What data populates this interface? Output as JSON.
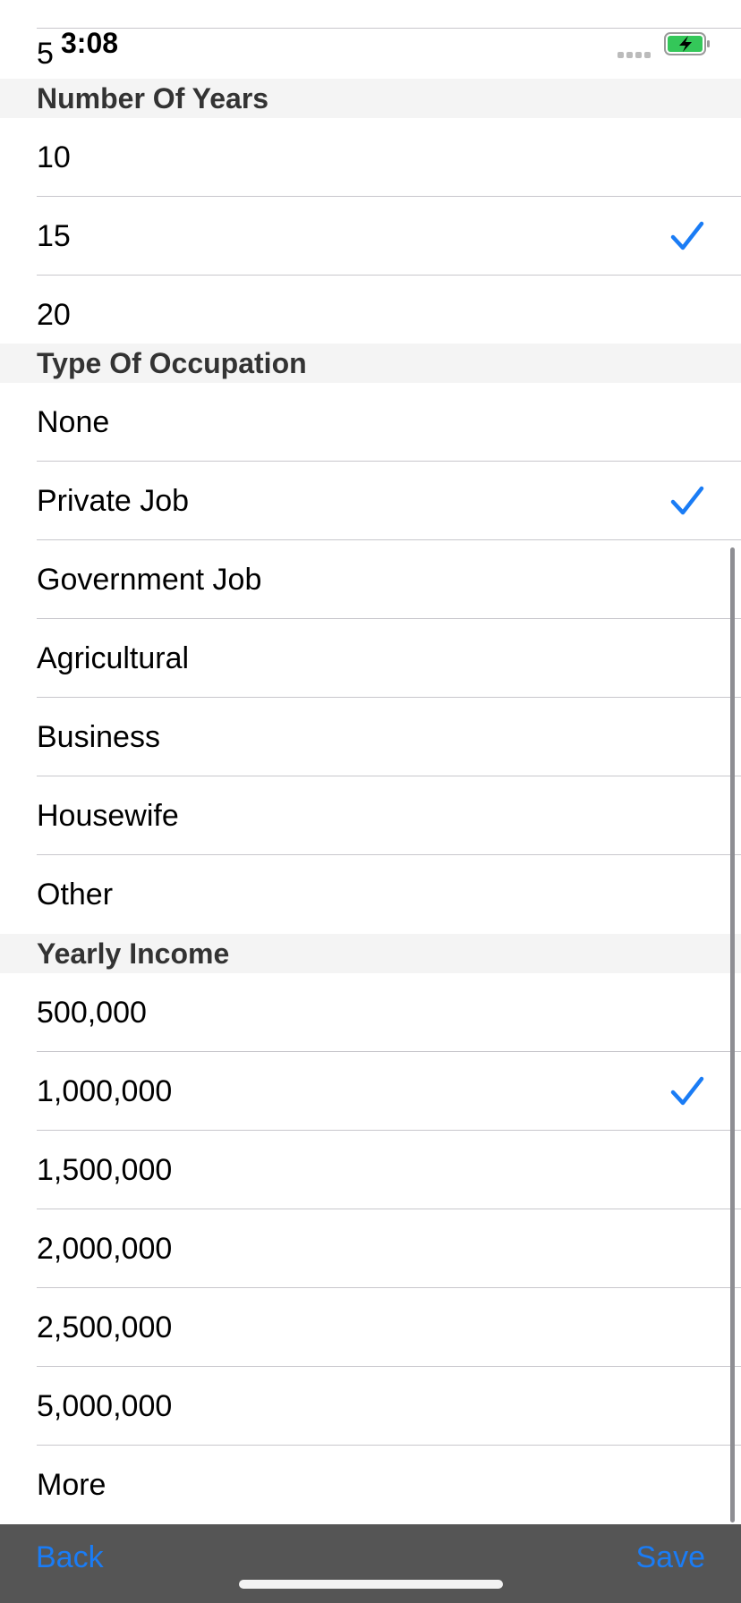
{
  "status_bar": {
    "time": "3:08",
    "battery_color": "#34c759"
  },
  "accent_color": "#1a7cf5",
  "partial_row": {
    "label": "5"
  },
  "sections": [
    {
      "title": "Number Of Years",
      "options": [
        {
          "label": "10",
          "selected": false
        },
        {
          "label": "15",
          "selected": true
        },
        {
          "label": "20",
          "selected": false
        }
      ]
    },
    {
      "title": "Type Of Occupation",
      "options": [
        {
          "label": "None",
          "selected": false
        },
        {
          "label": "Private Job",
          "selected": true
        },
        {
          "label": "Government Job",
          "selected": false
        },
        {
          "label": "Agricultural",
          "selected": false
        },
        {
          "label": "Business",
          "selected": false
        },
        {
          "label": "Housewife",
          "selected": false
        },
        {
          "label": "Other",
          "selected": false
        }
      ]
    },
    {
      "title": "Yearly Income",
      "options": [
        {
          "label": "500,000",
          "selected": false
        },
        {
          "label": "1,000,000",
          "selected": true
        },
        {
          "label": "1,500,000",
          "selected": false
        },
        {
          "label": "2,000,000",
          "selected": false
        },
        {
          "label": "2,500,000",
          "selected": false
        },
        {
          "label": "5,000,000",
          "selected": false
        },
        {
          "label": "More",
          "selected": false
        }
      ]
    }
  ],
  "toolbar": {
    "back_label": "Back",
    "save_label": "Save"
  }
}
